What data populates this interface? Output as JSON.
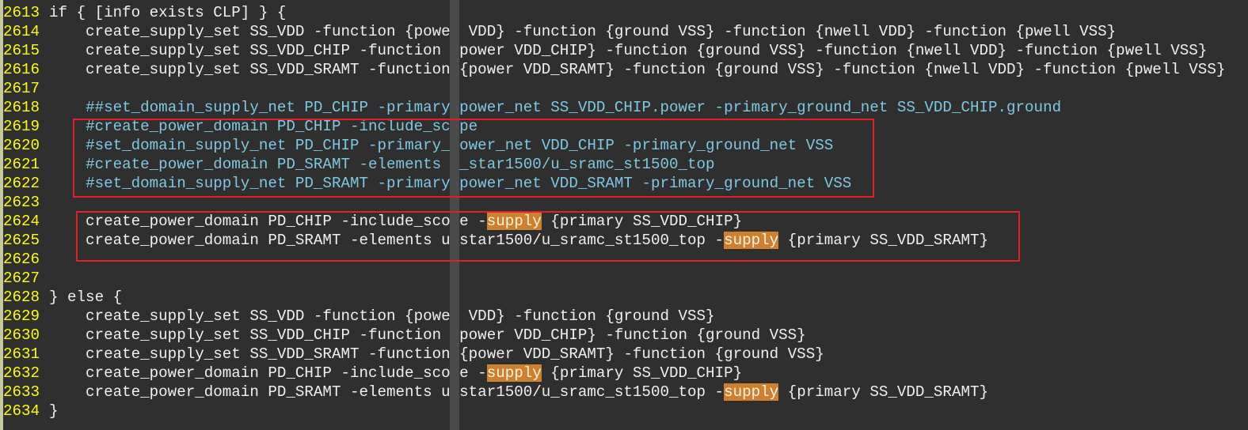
{
  "editor": {
    "lines": [
      {
        "num": "2613",
        "parts": [
          {
            "t": "if { [info exists CLP] } {",
            "c": "code"
          }
        ]
      },
      {
        "num": "2614",
        "parts": [
          {
            "t": "    create_supply_set SS_VDD -function {power VDD} -function {ground VSS} -function {nwell VDD} -function {pwell VSS}",
            "c": "code"
          }
        ]
      },
      {
        "num": "2615",
        "parts": [
          {
            "t": "    create_supply_set SS_VDD_CHIP -function {power VDD_CHIP} -function {ground VSS} -function {nwell VDD} -function {pwell VSS}",
            "c": "code"
          }
        ]
      },
      {
        "num": "2616",
        "parts": [
          {
            "t": "    create_supply_set SS_VDD_SRAMT -function {power VDD_SRAMT} -function {ground VSS} -function {nwell VDD} -function {pwell VSS}",
            "c": "code"
          }
        ]
      },
      {
        "num": "2617",
        "parts": []
      },
      {
        "num": "2618",
        "parts": [
          {
            "t": "    ",
            "c": "code"
          },
          {
            "t": "##set_domain_supply_net PD_CHIP -primary_power_net SS_VDD_CHIP.power -primary_ground_net SS_VDD_CHIP.ground",
            "c": "comment"
          }
        ]
      },
      {
        "num": "2619",
        "parts": [
          {
            "t": "    ",
            "c": "code"
          },
          {
            "t": "#create_power_domain PD_CHIP -include_scope",
            "c": "comment"
          }
        ]
      },
      {
        "num": "2620",
        "parts": [
          {
            "t": "    ",
            "c": "code"
          },
          {
            "t": "#set_domain_supply_net PD_CHIP -primary_power_net VDD_CHIP -primary_ground_net VSS",
            "c": "comment"
          }
        ]
      },
      {
        "num": "2621",
        "parts": [
          {
            "t": "    ",
            "c": "code"
          },
          {
            "t": "#create_power_domain PD_SRAMT -elements u_star1500/u_sramc_st1500_top",
            "c": "comment"
          }
        ]
      },
      {
        "num": "2622",
        "parts": [
          {
            "t": "    ",
            "c": "code"
          },
          {
            "t": "#set_domain_supply_net PD_SRAMT -primary_power_net VDD_SRAMT -primary_ground_net VSS",
            "c": "comment"
          }
        ]
      },
      {
        "num": "2623",
        "parts": []
      },
      {
        "num": "2624",
        "parts": [
          {
            "t": "    create_power_domain PD_CHIP -include_scope -",
            "c": "code"
          },
          {
            "t": "supply",
            "c": "hl"
          },
          {
            "t": " {primary SS_VDD_CHIP}",
            "c": "code"
          }
        ]
      },
      {
        "num": "2625",
        "parts": [
          {
            "t": "    create_power_domain PD_SRAMT -elements u_star1500/u_sramc_st1500_top -",
            "c": "code"
          },
          {
            "t": "supply",
            "c": "hl"
          },
          {
            "t": " {primary SS_VDD_SRAMT}",
            "c": "code"
          }
        ]
      },
      {
        "num": "2626",
        "parts": []
      },
      {
        "num": "2627",
        "parts": []
      },
      {
        "num": "2628",
        "parts": [
          {
            "t": "} else {",
            "c": "code"
          }
        ]
      },
      {
        "num": "2629",
        "parts": [
          {
            "t": "    create_supply_set SS_VDD -function {power VDD} -function {ground VSS}",
            "c": "code"
          }
        ]
      },
      {
        "num": "2630",
        "parts": [
          {
            "t": "    create_supply_set SS_VDD_CHIP -function {power VDD_CHIP} -function {ground VSS}",
            "c": "code"
          }
        ]
      },
      {
        "num": "2631",
        "parts": [
          {
            "t": "    create_supply_set SS_VDD_SRAMT -function {power VDD_SRAMT} -function {ground VSS}",
            "c": "code"
          }
        ]
      },
      {
        "num": "2632",
        "parts": [
          {
            "t": "    create_power_domain PD_CHIP -include_scope -",
            "c": "code"
          },
          {
            "t": "supply",
            "c": "hl"
          },
          {
            "t": " {primary SS_VDD_CHIP}",
            "c": "code"
          }
        ]
      },
      {
        "num": "2633",
        "parts": [
          {
            "t": "    create_power_domain PD_SRAMT -elements u_star1500/u_sramc_st1500_top -",
            "c": "code"
          },
          {
            "t": "supply",
            "c": "hl"
          },
          {
            "t": " {primary SS_VDD_SRAMT}",
            "c": "code"
          }
        ]
      },
      {
        "num": "2634",
        "parts": [
          {
            "t": "}",
            "c": "code"
          }
        ]
      }
    ]
  },
  "colors": {
    "background": "#2f2f2f",
    "line_number": "#ffff00",
    "code_text": "#f0f0f0",
    "comment_text": "#7ec8e3",
    "search_highlight": "#d07f2e",
    "annotation_box": "#e0202a"
  }
}
